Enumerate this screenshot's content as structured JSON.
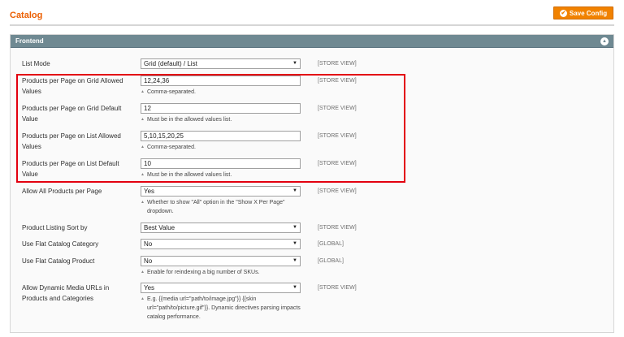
{
  "header": {
    "title": "Catalog",
    "save_label": "Save Config",
    "save_icon": "save-icon"
  },
  "section": {
    "title": "Frontend",
    "collapse_icon": "collapse-up-icon"
  },
  "fields": [
    {
      "label": "List Mode",
      "value": "Grid (default) / List",
      "type": "select",
      "scope": "[STORE VIEW]",
      "note": ""
    },
    {
      "label": "Products per Page on Grid Allowed Values",
      "value": "12,24,36",
      "type": "text",
      "scope": "[STORE VIEW]",
      "note": "Comma-separated."
    },
    {
      "label": "Products per Page on Grid Default Value",
      "value": "12",
      "type": "text",
      "scope": "[STORE VIEW]",
      "note": "Must be in the allowed values list."
    },
    {
      "label": "Products per Page on List Allowed Values",
      "value": "5,10,15,20,25",
      "type": "text",
      "scope": "[STORE VIEW]",
      "note": "Comma-separated."
    },
    {
      "label": "Products per Page on List Default Value",
      "value": "10",
      "type": "text",
      "scope": "[STORE VIEW]",
      "note": "Must be in the allowed values list."
    },
    {
      "label": "Allow All Products per Page",
      "value": "Yes",
      "type": "select",
      "scope": "[STORE VIEW]",
      "note": "Whether to show \"All\" option in the \"Show X Per Page\" dropdown."
    },
    {
      "label": "Product Listing Sort by",
      "value": "Best Value",
      "type": "select",
      "scope": "[STORE VIEW]",
      "note": ""
    },
    {
      "label": "Use Flat Catalog Category",
      "value": "No",
      "type": "select",
      "scope": "[GLOBAL]",
      "note": ""
    },
    {
      "label": "Use Flat Catalog Product",
      "value": "No",
      "type": "select",
      "scope": "[GLOBAL]",
      "note": "Enable for reindexing a big number of SKUs."
    },
    {
      "label": "Allow Dynamic Media URLs in Products and Categories",
      "value": "Yes",
      "type": "select",
      "scope": "[STORE VIEW]",
      "note": "E.g. {{media url=\"path/to/image.jpg\"}} {{skin url=\"path/to/picture.gif\"}}. Dynamic directives parsing impacts catalog performance."
    }
  ],
  "colors": {
    "accent": "#eb5e00",
    "button": "#f18200",
    "section_header": "#6f8992",
    "highlight": "#e3000f"
  }
}
